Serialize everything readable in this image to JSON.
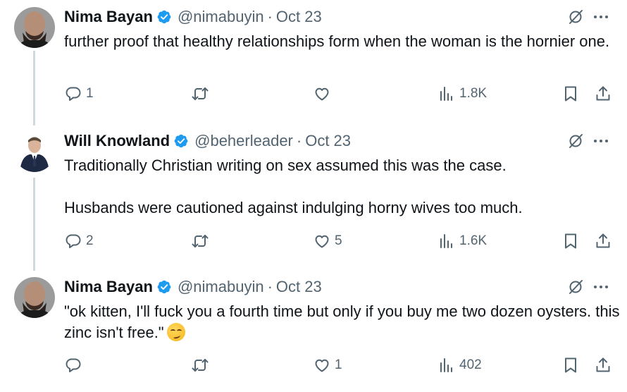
{
  "tweets": [
    {
      "name": "Nima Bayan",
      "handle": "@nimabuyin",
      "dot": "·",
      "date": "Oct 23",
      "text": "further proof that healthy relationships form when the woman is the hornier one.",
      "replies": "1",
      "reposts": "",
      "likes": "",
      "views": "1.8K"
    },
    {
      "name": "Will Knowland",
      "handle": "@beherleader",
      "dot": "·",
      "date": "Oct 23",
      "text": "Traditionally Christian writing on sex assumed this was the case.\n\nHusbands were cautioned against indulging horny wives too much.",
      "replies": "2",
      "reposts": "",
      "likes": "5",
      "views": "1.6K"
    },
    {
      "name": "Nima Bayan",
      "handle": "@nimabuyin",
      "dot": "·",
      "date": "Oct 23",
      "text": "\"ok kitten, I'll fuck you a fourth time but only if you buy me two dozen oysters. this zinc isn't free.\"",
      "replies": "",
      "reposts": "",
      "likes": "1",
      "views": "402"
    }
  ],
  "icons": {
    "verified": "verified-badge-icon",
    "grok": "grok-icon",
    "more": "more-icon",
    "reply": "reply-icon",
    "repost": "repost-icon",
    "like": "like-icon",
    "views": "views-icon",
    "bookmark": "bookmark-icon",
    "share": "share-icon",
    "emoji": "smirking-face-emoji"
  },
  "colors": {
    "text": "#0f1419",
    "secondary": "#536471",
    "verified": "#1d9bf0",
    "thread_line": "#cfd9de"
  }
}
